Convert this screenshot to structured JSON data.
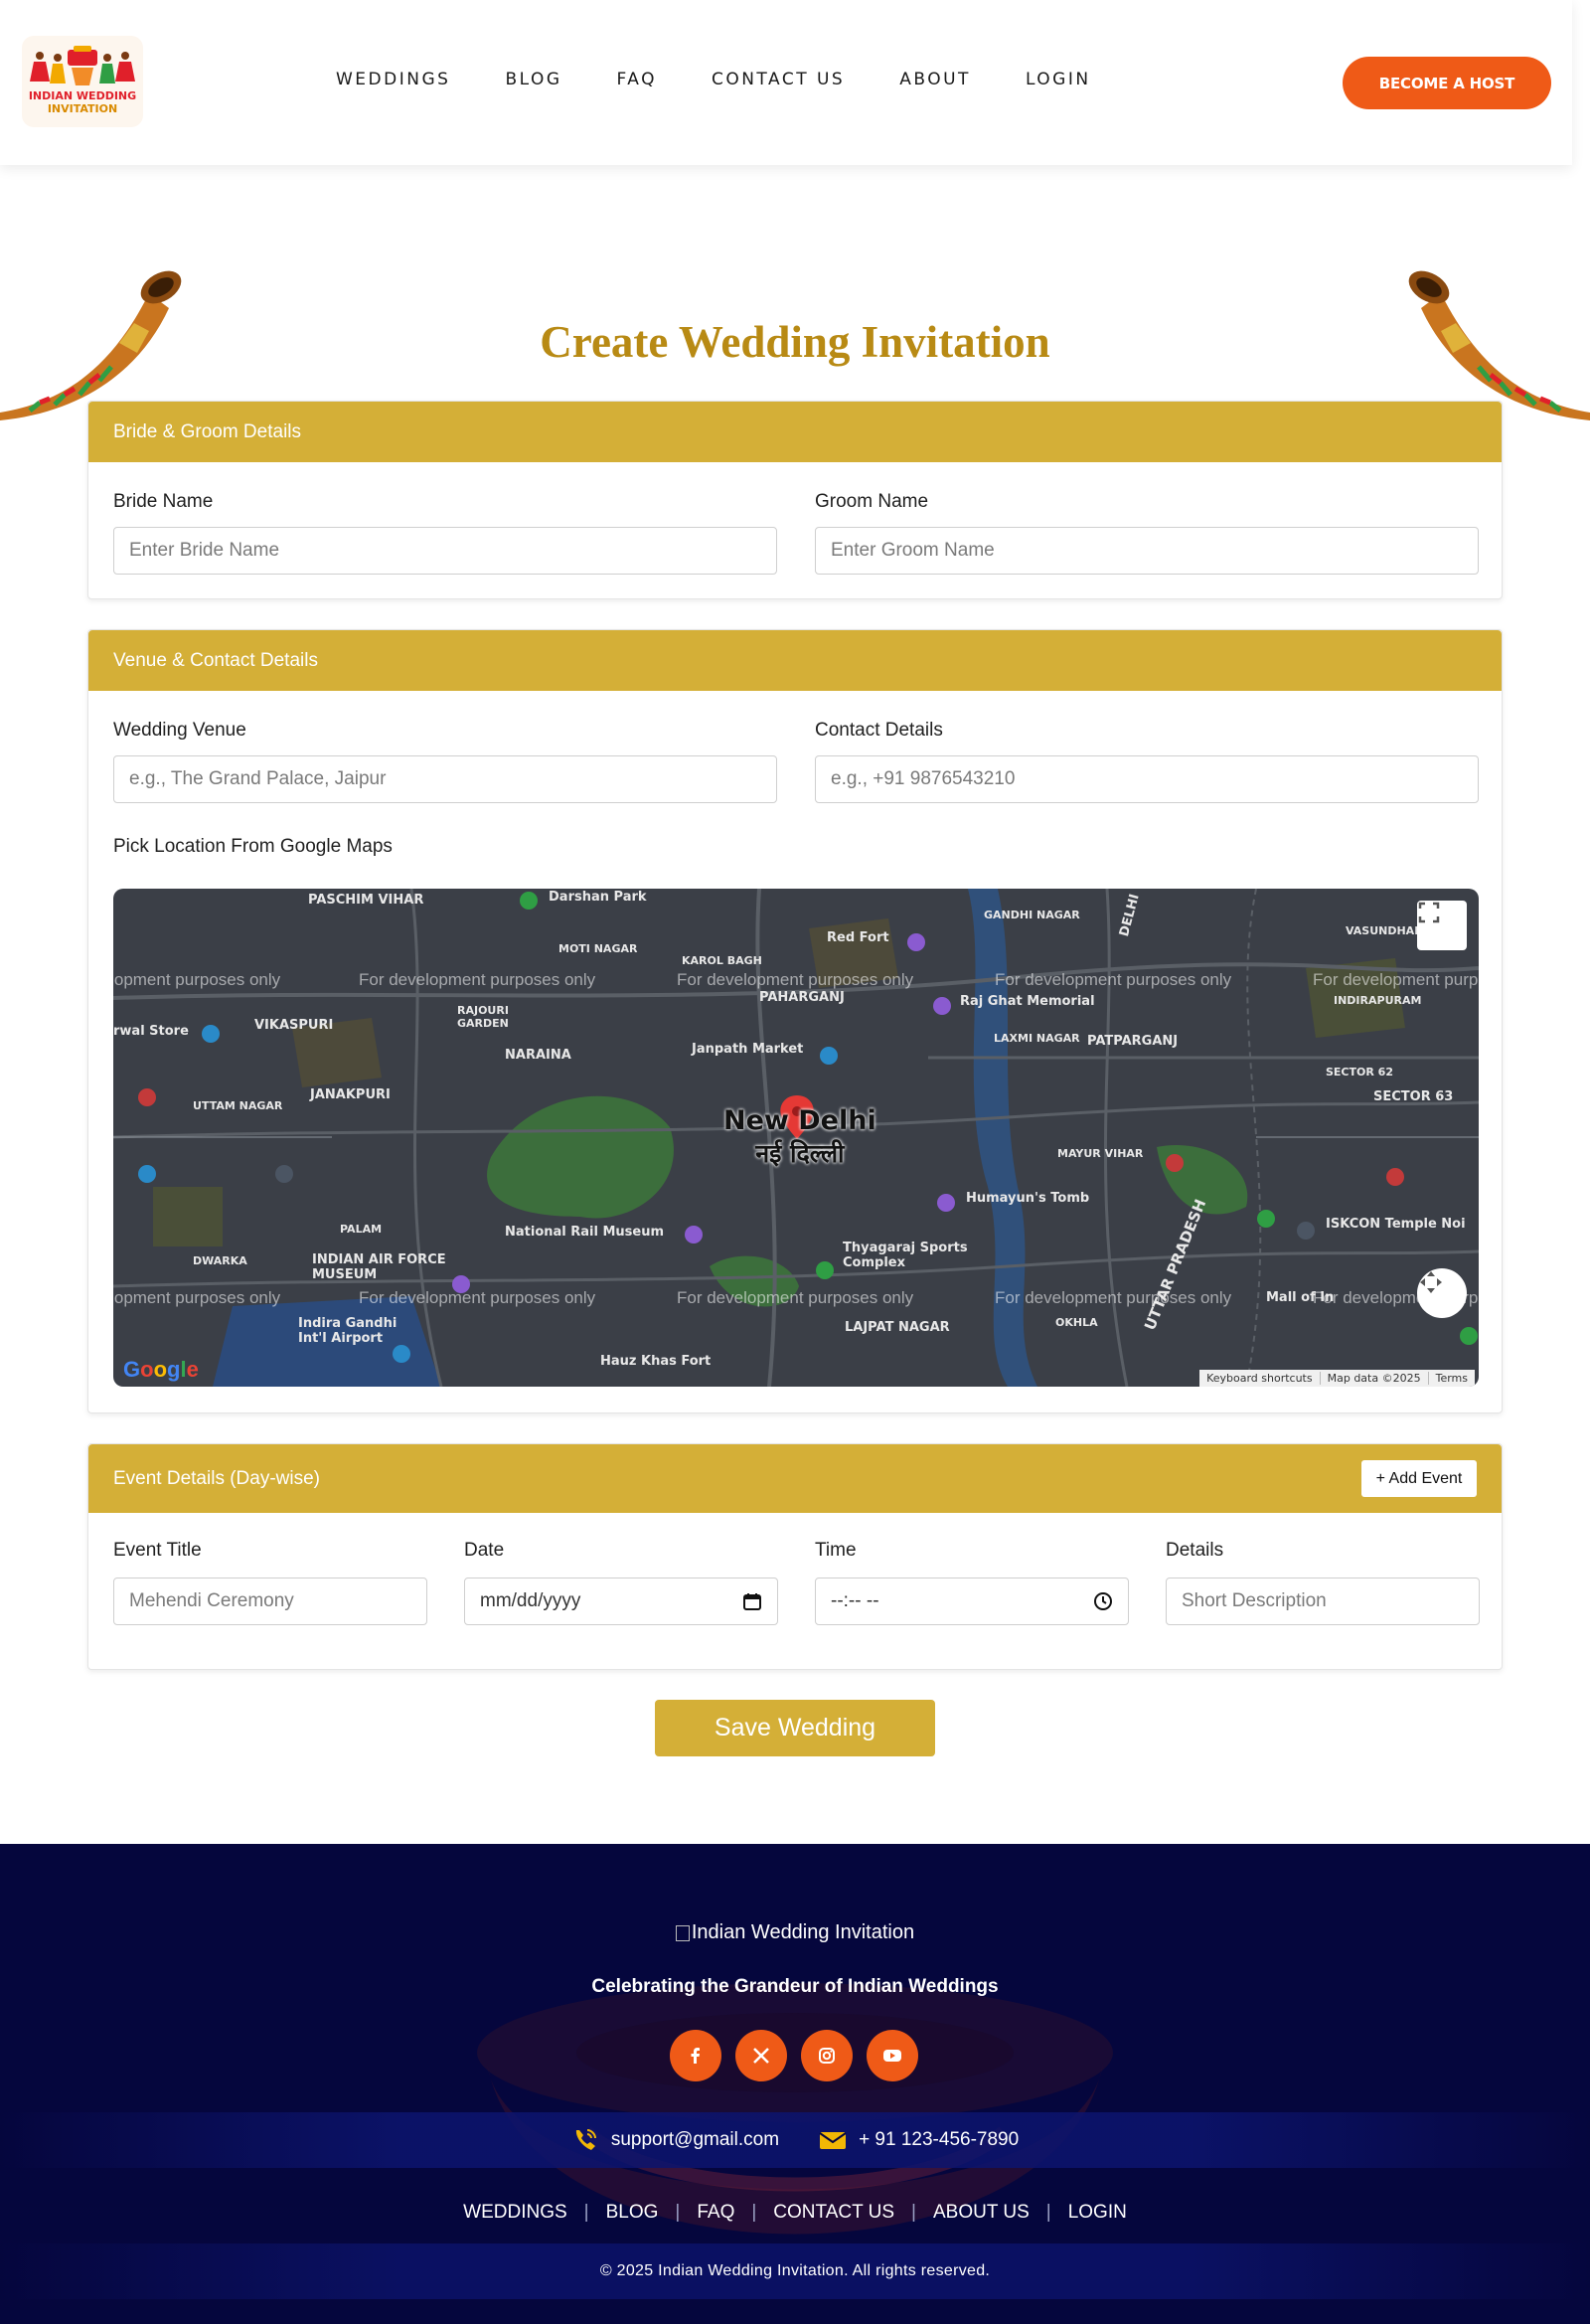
{
  "header": {
    "logo": {
      "line1": "INDIAN WEDDING",
      "line2": "INVITATION"
    },
    "nav": [
      {
        "label": "WEDDINGS"
      },
      {
        "label": "BLOG"
      },
      {
        "label": "FAQ"
      },
      {
        "label": "CONTACT US"
      },
      {
        "label": "ABOUT"
      },
      {
        "label": "LOGIN"
      }
    ],
    "cta": "BECOME A HOST"
  },
  "page": {
    "title": "Create Wedding Invitation"
  },
  "bride_groom": {
    "heading": "Bride & Groom Details",
    "bride_label": "Bride Name",
    "bride_placeholder": "Enter Bride Name",
    "groom_label": "Groom Name",
    "groom_placeholder": "Enter Groom Name"
  },
  "venue": {
    "heading": "Venue & Contact Details",
    "venue_label": "Wedding Venue",
    "venue_placeholder": "e.g., The Grand Palace, Jaipur",
    "contact_label": "Contact Details",
    "contact_placeholder": "e.g., +91 9876543210",
    "map_label": "Pick Location From Google Maps",
    "map": {
      "watermark": "For development purposes only",
      "city": "New Delhi",
      "city_hi": "नई दिल्ली",
      "places": [
        "PASCHIM VIHAR",
        "Darshan Park",
        "MOTI NAGAR",
        "KAROL BAGH",
        "Red Fort",
        "GANDHI NAGAR",
        "VASUNDHARA",
        "PAHARGANJ",
        "Raj Ghat Memorial",
        "INDIRAPURAM",
        "VIKASPURI",
        "RAJOURI GARDEN",
        "NARAINA",
        "Janpath Market",
        "LAXMI NAGAR",
        "PATPARGANJ",
        "SECTOR 62",
        "SECTOR 63",
        "UTTAM NAGAR",
        "JANAKPURI",
        "MAYUR VIHAR",
        "Humayun's Tomb",
        "ISKCON Temple Noi",
        "PALAM",
        "National Rail Museum",
        "Thyagaraj Sports Complex",
        "DWARKA",
        "INDIAN AIR FORCE MUSEUM",
        "Indira Gandhi Int'l Airport",
        "Hauz Khas Fort",
        "LAJPAT NAGAR",
        "OKHLA",
        "DELHI",
        "UTTAR PRADESH",
        "Mall of In",
        "rwal Store"
      ],
      "footer": [
        "Keyboard shortcuts",
        "Map data ©2025",
        "Terms"
      ],
      "google": "Google"
    }
  },
  "events": {
    "heading": "Event Details (Day-wise)",
    "add_button": "+ Add Event",
    "title_label": "Event Title",
    "title_placeholder": "Mehendi Ceremony",
    "date_label": "Date",
    "date_value": "mm/dd/yyyy",
    "time_label": "Time",
    "time_value": "--:-- --",
    "details_label": "Details",
    "details_placeholder": "Short Description"
  },
  "save_button": "Save Wedding",
  "footer": {
    "logo_alt": "Indian Wedding Invitation",
    "tagline": "Celebrating the Grandeur of Indian Weddings",
    "socials": [
      "facebook-icon",
      "x-icon",
      "instagram-icon",
      "youtube-icon"
    ],
    "email": "support@gmail.com",
    "phone": "+ 91 123-456-7890",
    "nav": [
      {
        "label": "WEDDINGS"
      },
      {
        "label": "BLOG"
      },
      {
        "label": "FAQ"
      },
      {
        "label": "CONTACT US"
      },
      {
        "label": "ABOUT US"
      },
      {
        "label": "LOGIN"
      }
    ],
    "copyright": "© 2025 Indian Wedding Invitation. All rights reserved."
  },
  "colors": {
    "accent_gold": "#d4af37",
    "title_gold": "#b88a14",
    "cta_orange": "#ef5a17",
    "footer_navy": "#05063d"
  }
}
